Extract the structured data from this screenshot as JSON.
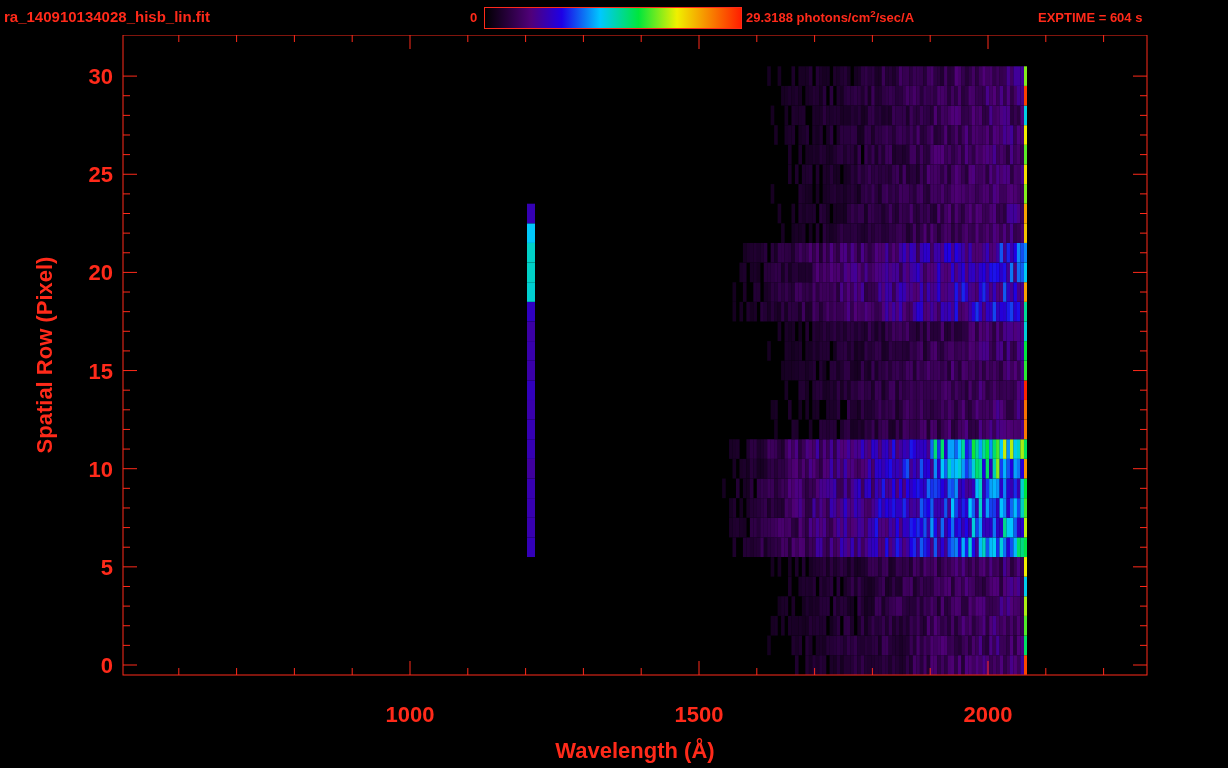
{
  "header": {
    "filename": "ra_140910134028_hisb_lin.fit",
    "colorbar_min": "0",
    "colorbar_max": "29.3188 photons/cm$^{2}$/sec/A",
    "exposure": "EXPTIME = 604 s"
  },
  "plot": {
    "xlabel": "Wavelength (Å)",
    "ylabel": "Spatial Row (Pixel)",
    "xticks": [
      "1000",
      "1500",
      "2000"
    ],
    "yticks": [
      "30",
      "25",
      "20",
      "15",
      "10",
      "5",
      "0"
    ]
  }
}
